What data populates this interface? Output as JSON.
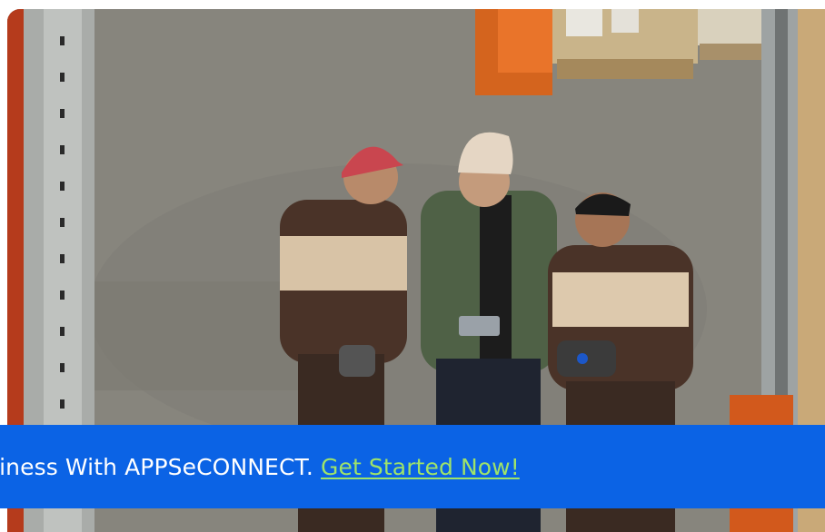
{
  "image": {
    "description_icon": "warehouse-workers-photo"
  },
  "banner": {
    "message": "siness With APPSeCONNECT.",
    "cta_label": "Get Started Now!",
    "background_color": "#0b63e5",
    "cta_color": "#9ee36a"
  }
}
